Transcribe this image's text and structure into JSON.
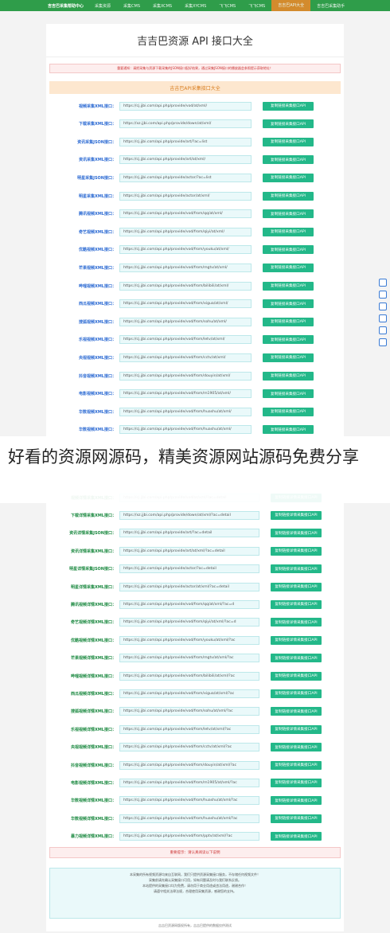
{
  "topbar": {
    "brand": "吉吉巴采集帮助中心",
    "nav": [
      "采集资源",
      "采集CMS",
      "采集XCMS",
      "采集XYCMS",
      "飞飞CMS",
      "飞飞CMS",
      "吉吉巴API大全",
      "吉吉巴采集助手"
    ]
  },
  "page": {
    "title": "吉吉巴资源 API 接口大全",
    "notice": "重要通知：请把采集与资源下载采集的JSON接口配好结果，通过采集JSON接口的播放器会参照提示获取地址！",
    "panel_title": "吉吉巴API采集接口大全",
    "copy_button": "复制链接采集接口API",
    "copy_button_b": "复制链接详情采集接口API"
  },
  "api_rows": [
    {
      "label": "视频采集XML接口：",
      "url": "https://cj.jjbi.com/api.php/provide/vod/at/xml/"
    },
    {
      "label": "下载采集XML接口：",
      "url": "https://xz.jjbi.com/api.php/provide/down/at/xml/"
    },
    {
      "label": "资讯采集JSON接口：",
      "url": "https://cj.jjbi.com/api.php/provide/art/?ac=list"
    },
    {
      "label": "资讯采集XML接口：",
      "url": "https://cj.jjbi.com/api.php/provide/art/at/xml/"
    },
    {
      "label": "明星采集JSON接口：",
      "url": "https://cj.jjbi.com/api.php/provide/actor/?ac=list"
    },
    {
      "label": "明星采集XML接口：",
      "url": "https://cj.jjbi.com/api.php/provide/actor/at/xml/"
    },
    {
      "label": "腾讯视频XML接口：",
      "url": "https://cj.jjbi.com/api.php/provide/vod/from/qq/at/xml/"
    },
    {
      "label": "奇艺视频XML接口：",
      "url": "https://cj.jjbi.com/api.php/provide/vod/from/qiyi/at/xml/"
    },
    {
      "label": "优酷视频XML接口：",
      "url": "https://cj.jjbi.com/api.php/provide/vod/from/youku/at/xml/"
    },
    {
      "label": "芒果视频XML接口：",
      "url": "https://cj.jjbi.com/api.php/provide/vod/from/mgtv/at/xml/"
    },
    {
      "label": "哔哩视频XML接口：",
      "url": "https://cj.jjbi.com/api.php/provide/vod/from/bilibili/at/xml/"
    },
    {
      "label": "西瓜视频XML接口：",
      "url": "https://cj.jjbi.com/api.php/provide/vod/from/xigua/at/xml/"
    },
    {
      "label": "搜狐视频XML接口：",
      "url": "https://cj.jjbi.com/api.php/provide/vod/from/sohu/at/xml/"
    },
    {
      "label": "乐视视频XML接口：",
      "url": "https://cj.jjbi.com/api.php/provide/vod/from/letv/at/xml/"
    },
    {
      "label": "央视视频XML接口：",
      "url": "https://cj.jjbi.com/api.php/provide/vod/from/cctv/at/xml/"
    },
    {
      "label": "抖音视频XML接口：",
      "url": "https://cj.jjbi.com/api.php/provide/vod/from/douyin/at/xml/"
    },
    {
      "label": "电影视频XML接口：",
      "url": "https://cj.jjbi.com/api.php/provide/vod/from/m1905/at/xml/"
    },
    {
      "label": "华数视频XML接口：",
      "url": "https://cj.jjbi.com/api.php/provide/vod/from/huashu/at/xml/"
    },
    {
      "label": "华数视频XML接口：",
      "url": "https://cj.jjbi.com/api.php/provide/vod/from/huashu/at/xml/"
    }
  ],
  "overlay": {
    "text": "好看的资源网源码，精美资源网站源码免费分享"
  },
  "detail_rows": [
    {
      "label": "视频详情采集XML接口：",
      "url": "https://cj.jjbi.com/api.php/provide/vod/at/xml/?ac=detail"
    },
    {
      "label": "下载详情采集XML接口：",
      "url": "https://xz.jjbi.com/api.php/provide/down/at/xml/?ac=detail"
    },
    {
      "label": "资讯详情采集JSON接口：",
      "url": "https://cj.jjbi.com/api.php/provide/art/?ac=detail"
    },
    {
      "label": "资讯详情采集XML接口：",
      "url": "https://cj.jjbi.com/api.php/provide/art/at/xml/?ac=detail"
    },
    {
      "label": "明星详情采集JSON接口：",
      "url": "https://cj.jjbi.com/api.php/provide/actor/?ac=detail"
    },
    {
      "label": "明星详情采集XML接口：",
      "url": "https://cj.jjbi.com/api.php/provide/actor/at/xml/?ac=detail"
    },
    {
      "label": "腾讯视频详情XML接口：",
      "url": "https://cj.jjbi.com/api.php/provide/vod/from/qq/at/xml/?ac=d"
    },
    {
      "label": "奇艺视频详情XML接口：",
      "url": "https://cj.jjbi.com/api.php/provide/vod/from/qiyi/at/xml/?ac=d"
    },
    {
      "label": "优酷视频详情XML接口：",
      "url": "https://cj.jjbi.com/api.php/provide/vod/from/youku/at/xml/?ac"
    },
    {
      "label": "芒果视频详情XML接口：",
      "url": "https://cj.jjbi.com/api.php/provide/vod/from/mgtv/at/xml/?ac"
    },
    {
      "label": "哔哩视频详情XML接口：",
      "url": "https://cj.jjbi.com/api.php/provide/vod/from/bilibili/at/xml/?ac"
    },
    {
      "label": "西瓜视频详情XML接口：",
      "url": "https://cj.jjbi.com/api.php/provide/vod/from/xigua/at/xml/?ac"
    },
    {
      "label": "搜狐视频详情XML接口：",
      "url": "https://cj.jjbi.com/api.php/provide/vod/from/sohu/at/xml/?ac"
    },
    {
      "label": "乐视视频详情XML接口：",
      "url": "https://cj.jjbi.com/api.php/provide/vod/from/letv/at/xml/?ac"
    },
    {
      "label": "央视视频详情XML接口：",
      "url": "https://cj.jjbi.com/api.php/provide/vod/from/cctv/at/xml/?ac"
    },
    {
      "label": "抖音视频详情XML接口：",
      "url": "https://cj.jjbi.com/api.php/provide/vod/from/douyin/at/xml/?ac"
    },
    {
      "label": "电影视频详情XML接口：",
      "url": "https://cj.jjbi.com/api.php/provide/vod/from/m1905/at/xml/?ac"
    },
    {
      "label": "华数视频详情XML接口：",
      "url": "https://cj.jjbi.com/api.php/provide/vod/from/huashu/at/xml/?ac"
    },
    {
      "label": "华数视频详情XML接口：",
      "url": "https://cj.jjbi.com/api.php/provide/vod/from/huashu/at/xml/?ac"
    },
    {
      "label": "暴力视频详情XML接口：",
      "url": "https://cj.jjbi.com/api.php/provide/vod/from/pptv/at/xml/?ac"
    }
  ],
  "footer": {
    "notice": "重要提示：请认真阅读以下说明",
    "lines": [
      "本采集的所有视频资源均来自互联网，我们只提供资源采集接口服务，不存储任何视频文件！",
      "采集前请先确认采集接口可用，如有问题请及时与我们联系反馈。",
      "本站提供的采集接口均为免费，请勿用于商业用途或违法用途，谢谢合作！",
      "请遵守相关法律法规，合理使用采集资源，感谢您的支持。"
    ],
    "copyright": "吉吉巴资源网版权所有，吉吉巴提供的数据仅供测试"
  }
}
